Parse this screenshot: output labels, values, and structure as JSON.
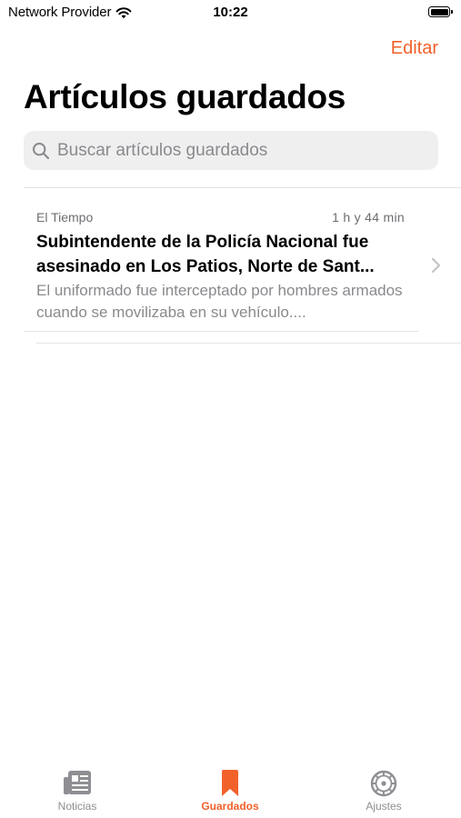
{
  "status_bar": {
    "carrier": "Network Provider",
    "time": "10:22"
  },
  "nav": {
    "edit_label": "Editar",
    "title": "Artículos guardados"
  },
  "search": {
    "placeholder": "Buscar artículos guardados",
    "value": ""
  },
  "articles": [
    {
      "source": "El Tiempo",
      "time": "1 h y 44 min",
      "title": "Subintendente de la Policía Nacional fue asesinado en Los Patios, Norte de Sant...",
      "summary": "El uniformado fue interceptado por hombres armados cuando se movilizaba en su vehículo...."
    }
  ],
  "tabs": [
    {
      "label": "Noticias",
      "icon": "newspaper-icon",
      "active": false
    },
    {
      "label": "Guardados",
      "icon": "bookmark-icon",
      "active": true
    },
    {
      "label": "Ajustes",
      "icon": "gear-icon",
      "active": false
    }
  ],
  "colors": {
    "accent": "#f2612a",
    "inactive": "#8e8e93",
    "secondary_text": "#8a8a8e",
    "search_bg": "#efeff0"
  }
}
